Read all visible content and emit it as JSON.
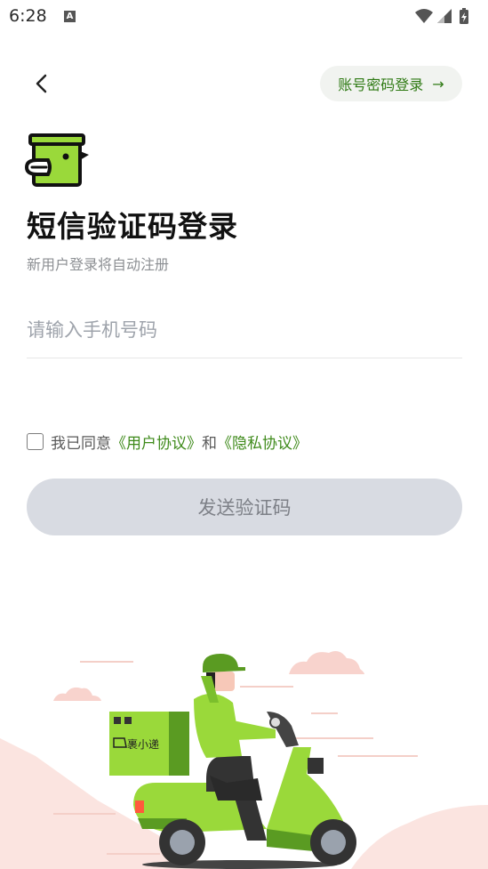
{
  "status_bar": {
    "time": "6:28",
    "notification_glyph": "A"
  },
  "header": {
    "password_login_label": "账号密码登录",
    "arrow": "→"
  },
  "title": "短信验证码登录",
  "subtitle": "新用户登录将自动注册",
  "phone_input": {
    "placeholder": "请输入手机号码",
    "value": ""
  },
  "agreement": {
    "prefix": "我已同意",
    "user_agreement": "《用户协议》",
    "and": "和",
    "privacy_agreement": "《隐私协议》"
  },
  "send_code_label": "发送验证码",
  "illustration": {
    "box_label": "裹小递"
  },
  "colors": {
    "brand_green": "#9ad93a",
    "link_green": "#3e8a1a",
    "button_disabled": "#d8dbe2"
  }
}
